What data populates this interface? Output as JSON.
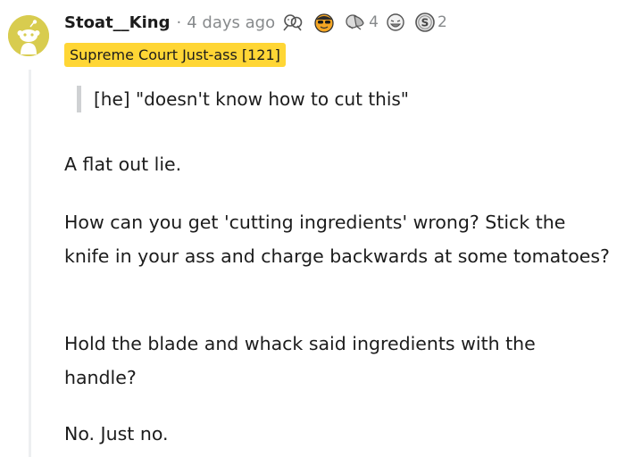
{
  "comment": {
    "author": "Stoat__King",
    "separator": "·",
    "timestamp": "4 days ago",
    "awards": [
      {
        "icon": "hugz-award-icon",
        "count": ""
      },
      {
        "icon": "sunglasses-face-award-icon",
        "count": ""
      },
      {
        "icon": "facepalm-award-icon",
        "count": "4"
      },
      {
        "icon": "laughing-face-award-icon",
        "count": ""
      },
      {
        "icon": "silver-coin-award-icon",
        "count": "2"
      }
    ],
    "flair": "Supreme Court Just-ass [121]",
    "quote": "[he] \"doesn't know how to cut this\"",
    "paragraphs": [
      "A flat out lie.",
      "How can you get 'cutting ingredients' wrong? Stick the knife in your ass and charge backwards at some tomatoes?",
      "Hold the blade and whack said ingredients with the handle?",
      "No. Just no."
    ]
  },
  "colors": {
    "avatar_bg": "#d8cc4f",
    "flair_bg": "#ffd635",
    "meta_text": "#878a8c",
    "thread_line": "#edeff1"
  }
}
